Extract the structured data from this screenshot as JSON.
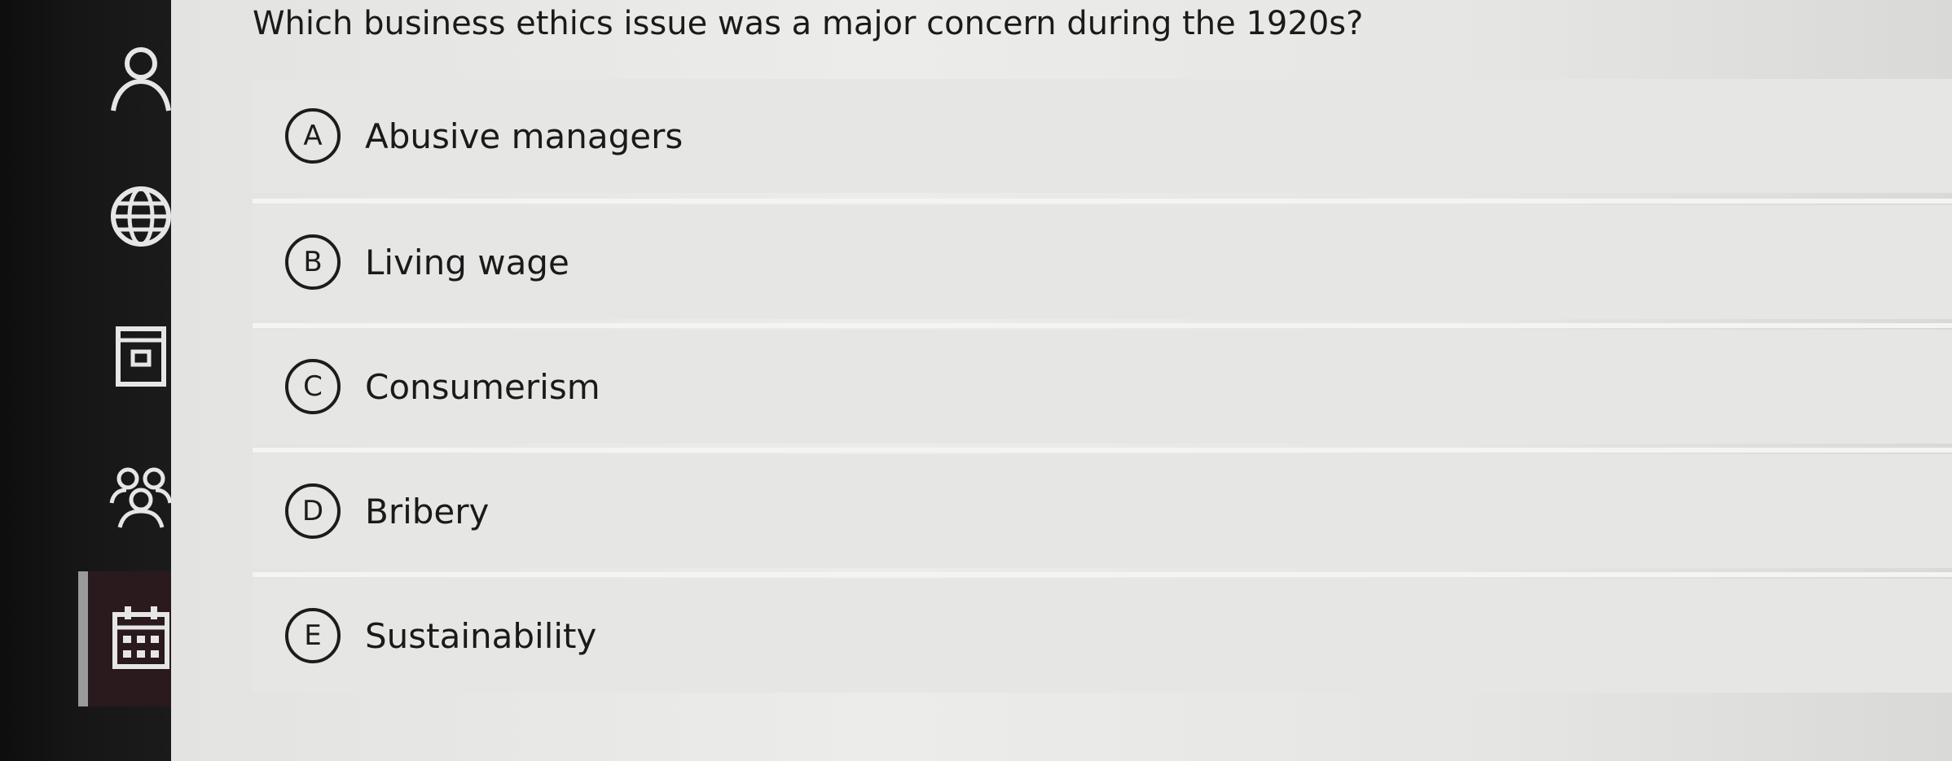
{
  "question": {
    "text": "Which business ethics issue was a major concern during the 1920s?"
  },
  "choices": [
    {
      "letter": "A",
      "label": "Abusive managers"
    },
    {
      "letter": "B",
      "label": "Living wage"
    },
    {
      "letter": "C",
      "label": "Consumerism"
    },
    {
      "letter": "D",
      "label": "Bribery"
    },
    {
      "letter": "E",
      "label": "Sustainability"
    }
  ],
  "sidebar": {
    "icons": [
      "user-icon",
      "globe-icon",
      "content-icon",
      "groups-icon",
      "calendar-icon"
    ],
    "active_icon": "calendar-icon"
  },
  "colors": {
    "rail": "#141414",
    "content": "#e8e8e6",
    "text": "#1a1a1a",
    "icon": "#e6e6e6"
  }
}
